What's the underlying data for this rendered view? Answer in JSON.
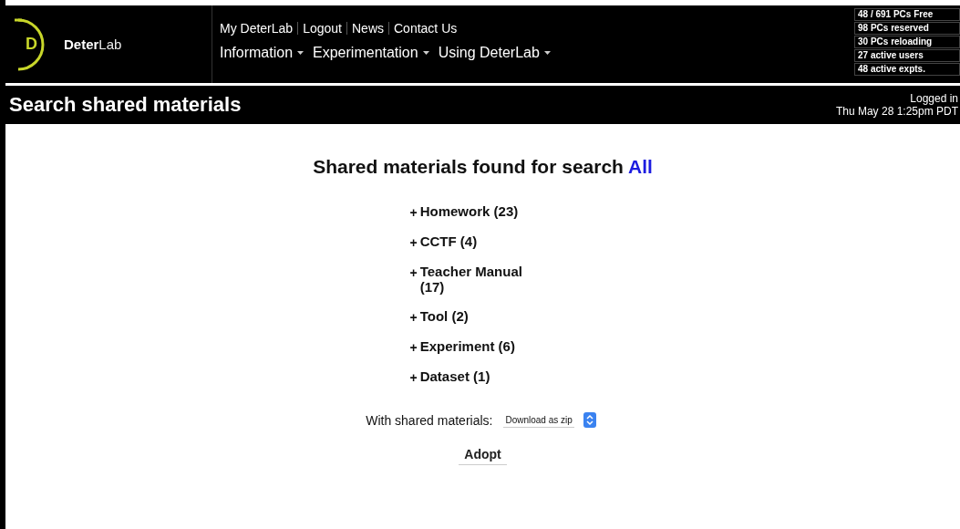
{
  "logo": {
    "letter": "D",
    "text": "**Deter**Lab"
  },
  "top_links": [
    "My DeterLab",
    "Logout",
    "News",
    "Contact Us"
  ],
  "menus": [
    "Information",
    "Experimentation",
    "Using DeterLab"
  ],
  "stats": [
    "48 / 691 PCs Free",
    "98 PCs reserved",
    "30 PCs reloading",
    "27 active users",
    "48 active expts."
  ],
  "title_bar": {
    "title": "Search shared materials",
    "status": "Logged in",
    "datetime": "Thu May 28 1:25pm PDT"
  },
  "heading": {
    "text": "Shared materials found for search",
    "term": "All"
  },
  "categories": [
    {
      "toggle": "+",
      "label": "Homework (23)",
      "expanded": false
    },
    {
      "toggle": "+",
      "label": "CCTF (4)",
      "expanded": false
    },
    {
      "toggle": "+",
      "label": "Teacher Manual (17)",
      "expanded": false
    },
    {
      "toggle": "+",
      "label": "Tool (2)",
      "expanded": false
    },
    {
      "toggle": "+",
      "label": "Experiment (6)",
      "expanded": false
    },
    {
      "toggle": "+",
      "label": "Dataset (1)",
      "expanded": false
    }
  ],
  "actions": {
    "label": "With shared materials:",
    "select_value": "Download as zip",
    "button": "Adopt"
  }
}
